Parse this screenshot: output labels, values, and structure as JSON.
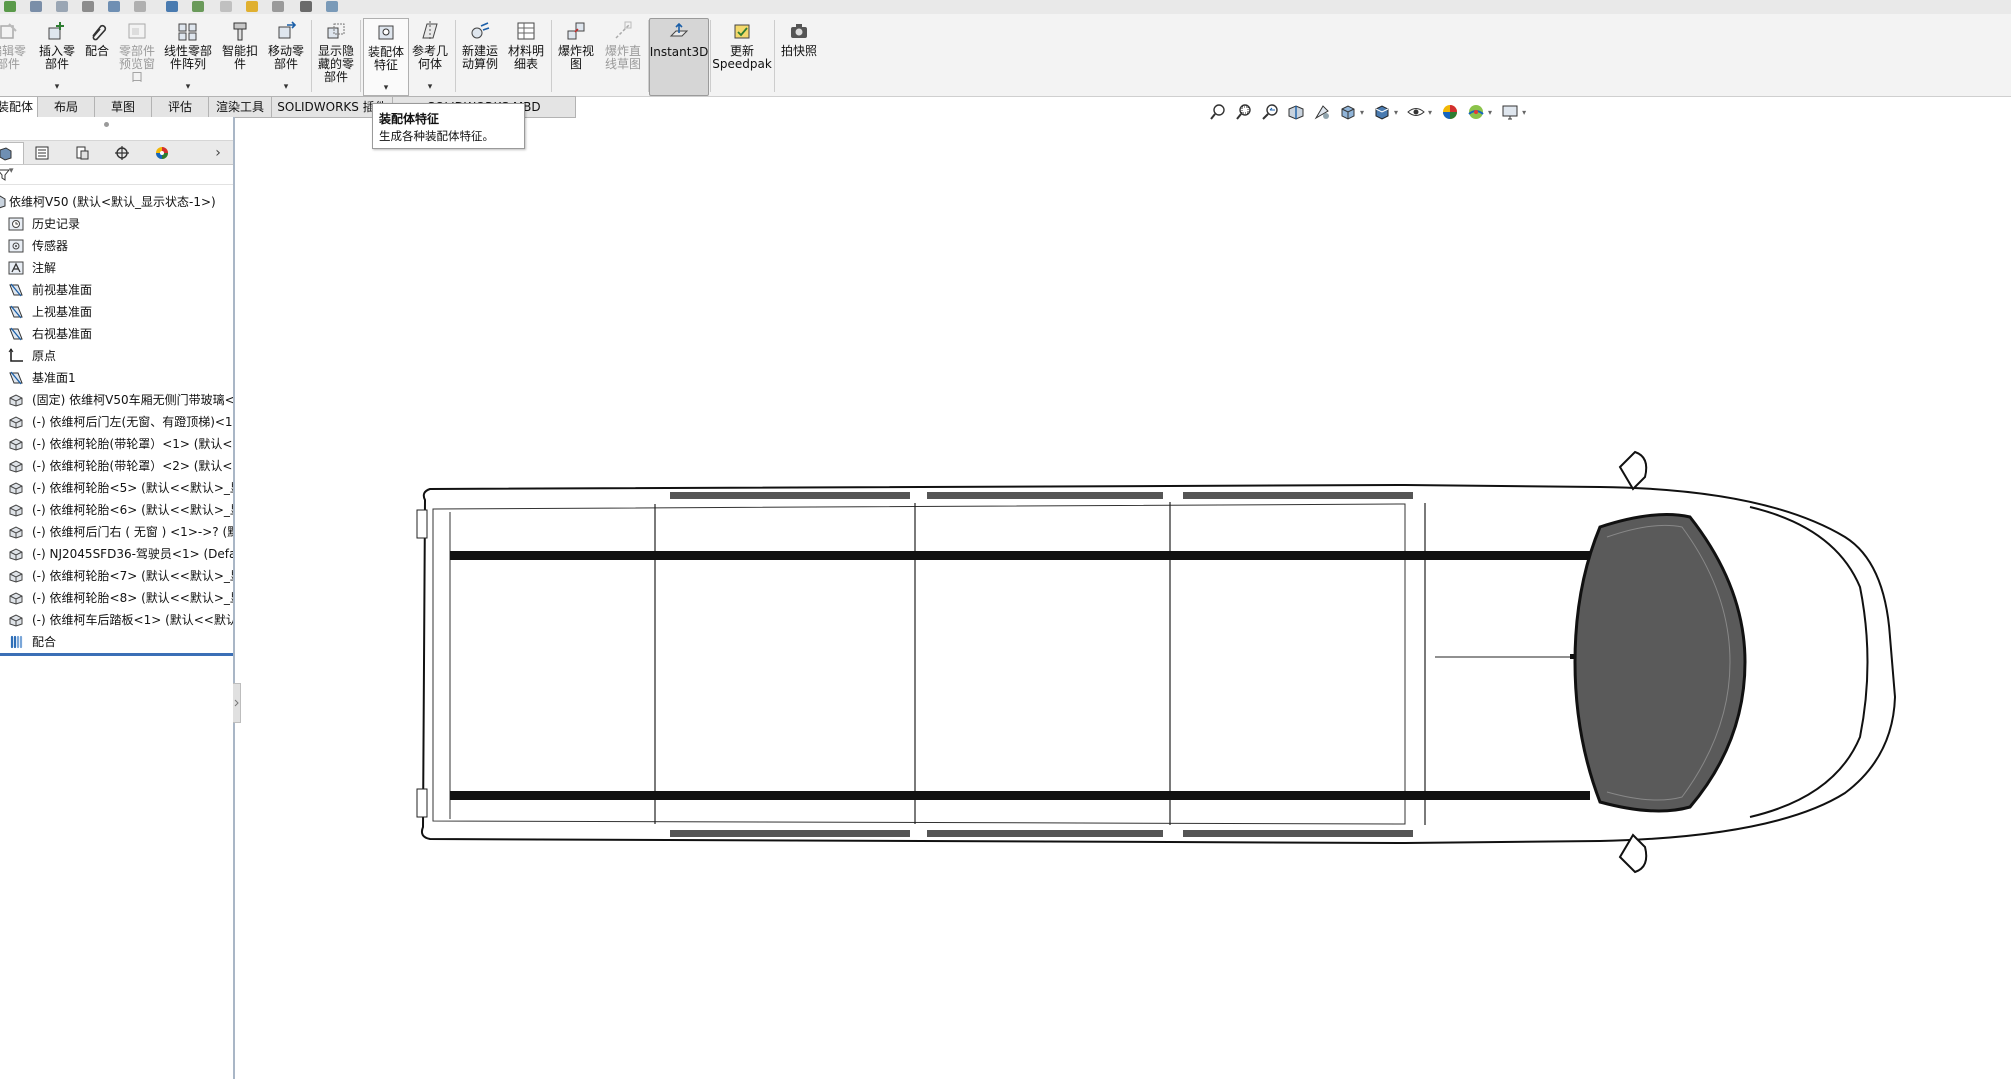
{
  "ribbon": {
    "buttons": [
      {
        "label": "编辑零\n部件",
        "disabled": true
      },
      {
        "label": "插入零\n部件",
        "dropdown": true
      },
      {
        "label": "配合"
      },
      {
        "label": "零部件\n预览窗\n口",
        "disabled": true
      },
      {
        "label": "线性零部\n件阵列",
        "dropdown": true
      },
      {
        "label": "智能扣\n件"
      },
      {
        "label": "移动零\n部件",
        "dropdown": true
      },
      {
        "label": "显示隐\n藏的零\n部件"
      },
      {
        "label": "装配体\n特征",
        "dropdown": true
      },
      {
        "label": "参考几\n何体",
        "dropdown": true
      },
      {
        "label": "新建运\n动算例"
      },
      {
        "label": "材料明\n细表"
      },
      {
        "label": "爆炸视\n图"
      },
      {
        "label": "爆炸直\n线草图",
        "disabled": true
      },
      {
        "label": "Instant3D",
        "active": true
      },
      {
        "label": "更新\nSpeedpak"
      },
      {
        "label": "拍快照"
      }
    ]
  },
  "tabs": [
    {
      "label": "装配体",
      "active": true
    },
    {
      "label": "布局"
    },
    {
      "label": "草图"
    },
    {
      "label": "评估"
    },
    {
      "label": "渲染工具"
    },
    {
      "label": "SOLIDWORKS 插件"
    },
    {
      "label": "SOLIDWORKS MBD"
    }
  ],
  "tooltip": {
    "title": "装配体特征",
    "description": "生成各种装配体特征。"
  },
  "tree": {
    "root": "依维柯V50  (默认<默认_显示状态-1>)",
    "items": [
      {
        "label": "历史记录",
        "icon": "history-icon"
      },
      {
        "label": "传感器",
        "icon": "sensor-icon"
      },
      {
        "label": "注解",
        "icon": "annotation-icon"
      },
      {
        "label": "前视基准面",
        "icon": "plane-icon"
      },
      {
        "label": "上视基准面",
        "icon": "plane-icon"
      },
      {
        "label": "右视基准面",
        "icon": "plane-icon"
      },
      {
        "label": "原点",
        "icon": "origin-icon"
      },
      {
        "label": "基准面1",
        "icon": "plane-icon"
      },
      {
        "label": "(固定) 依维柯V50车厢无侧门带玻璃<",
        "icon": "part-icon"
      },
      {
        "label": "(-) 依维柯后门左(无窗、有蹬顶梯)<1:",
        "icon": "part-icon"
      },
      {
        "label": "(-) 依维柯轮胎(带轮罩）<1> (默认<<",
        "icon": "part-icon"
      },
      {
        "label": "(-) 依维柯轮胎(带轮罩）<2> (默认<<",
        "icon": "part-icon"
      },
      {
        "label": "(-) 依维柯轮胎<5> (默认<<默认>_显",
        "icon": "part-icon"
      },
      {
        "label": "(-) 依维柯轮胎<6> (默认<<默认>_显",
        "icon": "part-icon"
      },
      {
        "label": "(-) 依维柯后门右 ( 无窗 ) <1>->? (默",
        "icon": "part-icon"
      },
      {
        "label": "(-) NJ2045SFD36-驾驶员<1> (Defau",
        "icon": "part-icon"
      },
      {
        "label": "(-) 依维柯轮胎<7> (默认<<默认>_显",
        "icon": "part-icon"
      },
      {
        "label": "(-) 依维柯轮胎<8> (默认<<默认>_显",
        "icon": "part-icon"
      },
      {
        "label": "(-) 依维柯车后踏板<1> (默认<<默认",
        "icon": "part-icon"
      },
      {
        "label": "配合",
        "icon": "mates-icon"
      }
    ]
  },
  "colors": {
    "ribbon_bg": "#f3f3f3",
    "accent_blue": "#3b6fb6",
    "tab_active_bg": "#ffffff"
  }
}
